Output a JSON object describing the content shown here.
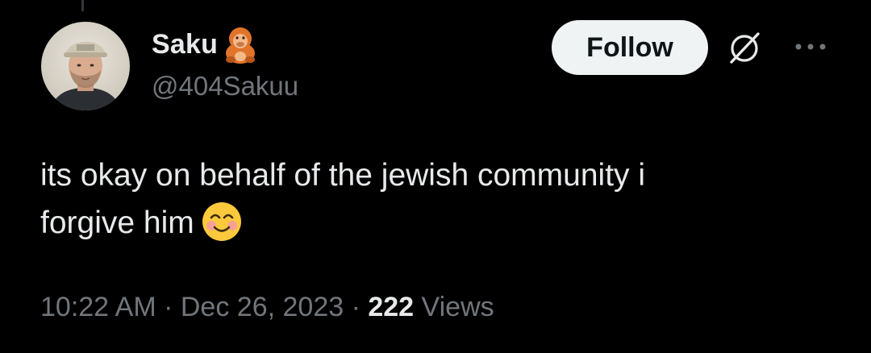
{
  "author": {
    "display_name": "Saku",
    "name_emoji": "orangutan-emoji",
    "handle": "@404Sakuu",
    "avatar": "profile-photo"
  },
  "actions": {
    "follow_label": "Follow",
    "grok_icon": "grok-icon",
    "more_icon": "more-dots-icon"
  },
  "tweet": {
    "line1": "its okay on behalf of the jewish community i",
    "line2": "forgive him",
    "emoji": "smiling-face-with-smiling-eyes"
  },
  "meta": {
    "time": "10:22 AM",
    "sep1": " · ",
    "date": "Dec 26, 2023",
    "sep2": " · ",
    "views_count": "222",
    "views_label": " Views"
  },
  "colors": {
    "background": "#000000",
    "text_primary": "#e7e9ea",
    "text_secondary": "#71767b",
    "follow_bg": "#eff3f4",
    "follow_text": "#0f1419"
  }
}
